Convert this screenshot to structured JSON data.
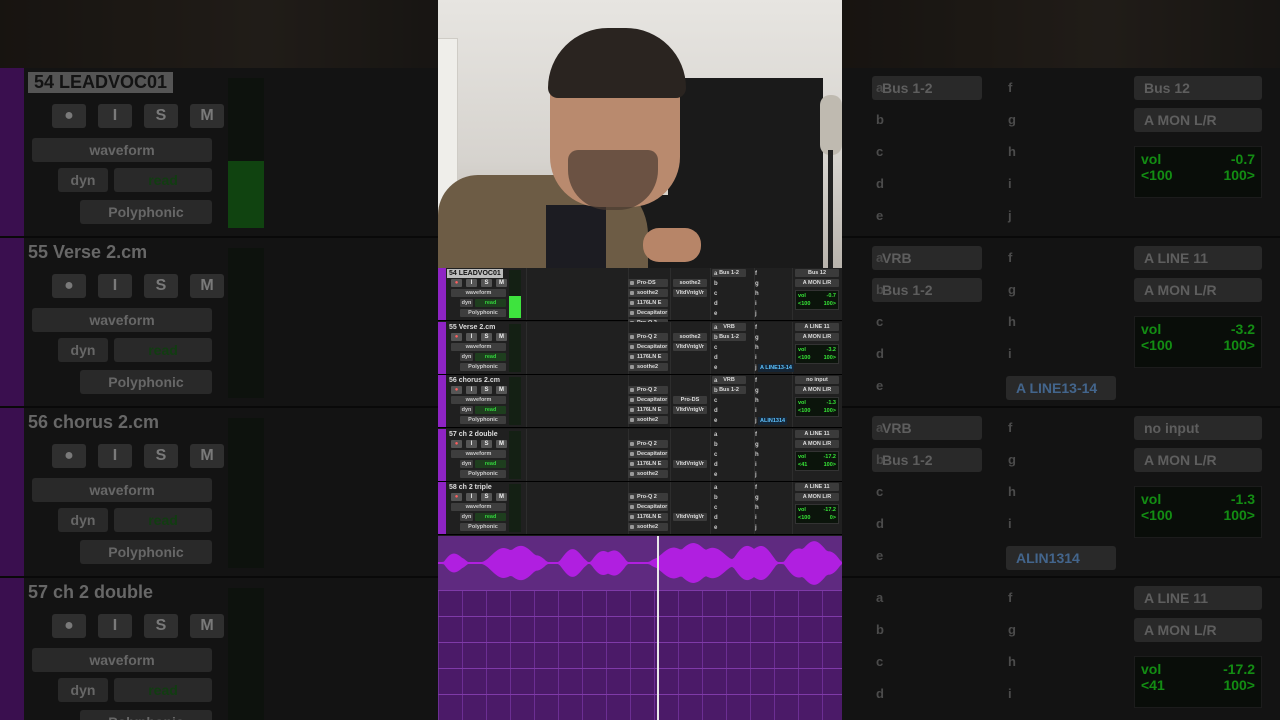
{
  "tracks": [
    {
      "name": "54 LEADVOC01",
      "view": "waveform",
      "auto": "read",
      "playlist": "dyn",
      "voice": "Polyphonic",
      "sends": [
        "Pro-DS",
        "soothe2",
        "1176LN E",
        "Decapitator",
        "Pro-Q 2"
      ],
      "inserts_b": [
        "",
        "soothe2",
        "VltdVntgVr",
        "",
        ""
      ],
      "sendrows": [
        "Bus 1-2",
        "",
        "",
        "",
        ""
      ],
      "letters_l": [
        "a",
        "b",
        "c",
        "d",
        "e"
      ],
      "letters_r": [
        "f",
        "g",
        "h",
        "i",
        "j"
      ],
      "output": "Bus 12",
      "input": "A MON L/R",
      "vol": "-0.7",
      "pan_l": "<100",
      "pan_r": "100>",
      "extra": ""
    },
    {
      "name": "55 Verse 2.cm",
      "view": "waveform",
      "auto": "read",
      "playlist": "dyn",
      "voice": "Polyphonic",
      "sends": [
        "Pro-Q 2",
        "Decapitator",
        "1176LN E",
        "soothe2",
        ""
      ],
      "inserts_b": [
        "",
        "soothe2",
        "VltdVntgVr",
        "",
        ""
      ],
      "sendrows": [
        "VRB",
        "Bus 1-2",
        "",
        "",
        ""
      ],
      "letters_l": [
        "a",
        "b",
        "c",
        "d",
        "e"
      ],
      "letters_r": [
        "f",
        "g",
        "h",
        "i",
        "j"
      ],
      "output": "A LINE 11",
      "input": "A MON L/R",
      "vol": "-3.2",
      "pan_l": "<100",
      "pan_r": "100>",
      "extra": "A LINE13-14"
    },
    {
      "name": "56 chorus 2.cm",
      "view": "waveform",
      "auto": "read",
      "playlist": "dyn",
      "voice": "Polyphonic",
      "sends": [
        "Pro-Q 2",
        "Decapitator",
        "1176LN E",
        "soothe2",
        ""
      ],
      "inserts_b": [
        "",
        "",
        "Pro-DS",
        "VltdVntgVr",
        ""
      ],
      "sendrows": [
        "VRB",
        "Bus 1-2",
        "",
        "",
        ""
      ],
      "letters_l": [
        "a",
        "b",
        "c",
        "d",
        "e"
      ],
      "letters_r": [
        "f",
        "g",
        "h",
        "i",
        "j"
      ],
      "output": "no input",
      "input": "A MON L/R",
      "vol": "-1.3",
      "pan_l": "<100",
      "pan_r": "100>",
      "extra": "ALIN1314"
    },
    {
      "name": "57 ch 2 double",
      "view": "waveform",
      "auto": "read",
      "playlist": "dyn",
      "voice": "Polyphonic",
      "sends": [
        "Pro-Q 2",
        "Decapitator",
        "1176LN E",
        "soothe2",
        ""
      ],
      "inserts_b": [
        "",
        "",
        "",
        "VltdVntgVr",
        ""
      ],
      "sendrows": [
        "",
        "",
        "",
        "",
        ""
      ],
      "letters_l": [
        "a",
        "b",
        "c",
        "d",
        "e"
      ],
      "letters_r": [
        "f",
        "g",
        "h",
        "i",
        "j"
      ],
      "output": "A LINE 11",
      "input": "A MON L/R",
      "vol": "-17.2",
      "pan_l": "<41",
      "pan_r": "100>",
      "extra": ""
    },
    {
      "name": "58 ch 2 triple",
      "view": "waveform",
      "auto": "read",
      "playlist": "dyn",
      "voice": "Polyphonic",
      "sends": [
        "Pro-Q 2",
        "Decapitator",
        "1176LN E",
        "soothe2",
        ""
      ],
      "inserts_b": [
        "",
        "",
        "",
        "VltdVntgVr",
        ""
      ],
      "sendrows": [
        "",
        "",
        "",
        "",
        ""
      ],
      "letters_l": [
        "a",
        "b",
        "c",
        "d",
        "e"
      ],
      "letters_r": [
        "f",
        "g",
        "h",
        "i",
        "j"
      ],
      "output": "A LINE 11",
      "input": "A MON L/R",
      "vol": "-17.2",
      "pan_l": "<100",
      "pan_r": "0>",
      "extra": ""
    }
  ],
  "buttons": {
    "rec": "●",
    "input": "I",
    "solo": "S",
    "mute": "M"
  },
  "big_left": [
    {
      "name": "54 LEADVOC01"
    },
    {
      "name": "55 Verse 2.cm"
    },
    {
      "name": "56 chorus 2.cm"
    },
    {
      "name": "57 ch 2 double"
    }
  ],
  "big_right": [
    {
      "send_a": "Bus 1-2",
      "send_b": "",
      "out": "Bus 12",
      "in": "A MON L/R",
      "vol_label": "vol",
      "vol": "-0.7",
      "pan_l": "<100",
      "pan_r": "100>",
      "extra": ""
    },
    {
      "send_a": "VRB",
      "send_b": "Bus 1-2",
      "out": "A LINE 11",
      "in": "A MON L/R",
      "vol_label": "vol",
      "vol": "-3.2",
      "pan_l": "<100",
      "pan_r": "100>",
      "extra": "A LINE13-14"
    },
    {
      "send_a": "VRB",
      "send_b": "Bus 1-2",
      "out": "no input",
      "in": "A MON L/R",
      "vol_label": "vol",
      "vol": "-1.3",
      "pan_l": "<100",
      "pan_r": "100>",
      "extra": "ALIN1314"
    },
    {
      "send_a": "",
      "send_b": "",
      "out": "A LINE 11",
      "in": "A MON L/R",
      "vol_label": "vol",
      "vol": "-17.2",
      "pan_l": "<41",
      "pan_r": "100>",
      "extra": ""
    }
  ],
  "labels": {
    "vol": "vol",
    "waveform": "waveform",
    "dyn": "dyn",
    "read": "read",
    "polyphonic": "Polyphonic"
  },
  "colors": {
    "track": "#8e24c4",
    "meter": "#3ee33e",
    "region": "#b01fe0"
  }
}
